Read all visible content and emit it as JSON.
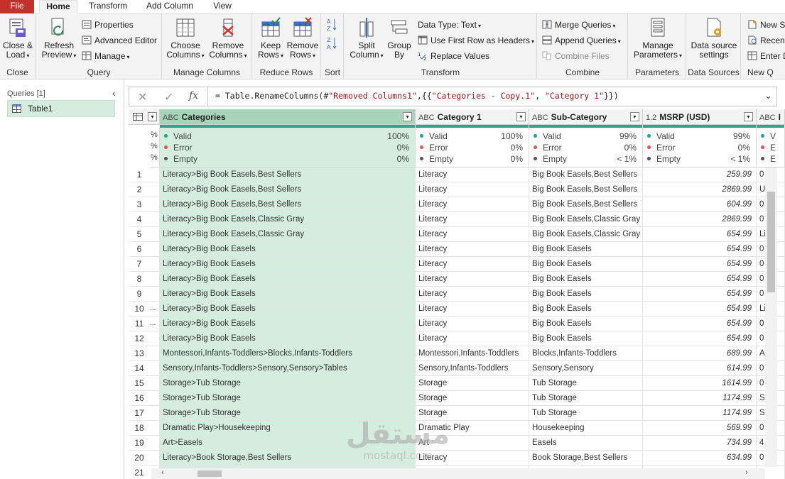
{
  "tabs": {
    "file": "File",
    "home": "Home",
    "transform": "Transform",
    "add_column": "Add Column",
    "view": "View"
  },
  "ribbon": {
    "close": {
      "btn1": "Close &",
      "btn2": "Load",
      "label": "Close"
    },
    "query": {
      "refresh1": "Refresh",
      "refresh2": "Preview",
      "properties": "Properties",
      "advanced": "Advanced Editor",
      "manage": "Manage",
      "label": "Query"
    },
    "manage_columns": {
      "choose1": "Choose",
      "choose2": "Columns",
      "remove1": "Remove",
      "remove2": "Columns",
      "label": "Manage Columns"
    },
    "reduce_rows": {
      "keep1": "Keep",
      "keep2": "Rows",
      "remove1": "Remove",
      "remove2": "Rows",
      "label": "Reduce Rows"
    },
    "sort": {
      "label": "Sort"
    },
    "transform": {
      "split1": "Split",
      "split2": "Column",
      "group1": "Group",
      "group2": "By",
      "datatype": "Data Type: Text",
      "firstrow": "Use First Row as Headers",
      "replace": "Replace Values",
      "label": "Transform"
    },
    "combine": {
      "merge": "Merge Queries",
      "append": "Append Queries",
      "combine_files": "Combine Files",
      "label": "Combine"
    },
    "parameters": {
      "manage1": "Manage",
      "manage2": "Parameters",
      "label": "Parameters"
    },
    "data_sources": {
      "ds1": "Data source",
      "ds2": "settings",
      "label": "Data Sources"
    },
    "new_query": {
      "new_source": "New So",
      "recent": "Recent",
      "enter": "Enter D",
      "label": "New Q"
    }
  },
  "queries_pane": {
    "header": "Queries [1]",
    "items": [
      {
        "label": "Table1"
      }
    ]
  },
  "formula": {
    "prefix": "= Table.RenameColumns(#",
    "s1": "\"Removed Columns1\"",
    "mid": ",{{",
    "s2": "\"Categories - Copy.1\"",
    "comma": ", ",
    "s3": "\"Category 1\"",
    "suffix": "}})"
  },
  "columns": [
    {
      "type": "ABC",
      "name": "Categories",
      "stats": {
        "valid": "100%",
        "error": "0%",
        "empty": "0%"
      }
    },
    {
      "type": "ABC",
      "name": "Category 1",
      "stats": {
        "valid": "100%",
        "error": "0%",
        "empty": "0%"
      }
    },
    {
      "type": "ABC",
      "name": "Sub-Category",
      "stats": {
        "valid": "99%",
        "error": "0%",
        "empty": "< 1%"
      }
    },
    {
      "type": "1.2",
      "name": "MSRP (USD)",
      "stats": {
        "valid": "99%",
        "error": "0%",
        "empty": "< 1%"
      }
    },
    {
      "type": "ABC",
      "name": "I",
      "stats": {
        "valid": "V",
        "error": "E",
        "empty": "E"
      }
    }
  ],
  "stat_labels": {
    "valid": "Valid",
    "error": "Error",
    "empty": "Empty"
  },
  "prev_col_partial": {
    "r1": "%",
    "r2": "%",
    "r3": "%"
  },
  "colors": {
    "valid": "#1aa38d",
    "error": "#e0524f",
    "empty": "#555555",
    "accent": "#28a78b",
    "selected": "#d5eddf"
  },
  "rows": [
    {
      "n": "1",
      "prev": "",
      "c1": "Literacy>Big Book Easels,Best Sellers",
      "c2": "Literacy",
      "c3": "Big Book Easels,Best Sellers",
      "c4": "259.99",
      "c5": "0"
    },
    {
      "n": "2",
      "prev": "",
      "c1": "Literacy>Big Book Easels,Best Sellers",
      "c2": "Literacy",
      "c3": "Big Book Easels,Best Sellers",
      "c4": "2869.99",
      "c5": "U"
    },
    {
      "n": "3",
      "prev": "",
      "c1": "Literacy>Big Book Easels,Best Sellers",
      "c2": "Literacy",
      "c3": "Big Book Easels,Best Sellers",
      "c4": "604.99",
      "c5": "0"
    },
    {
      "n": "4",
      "prev": "",
      "c1": "Literacy>Big Book Easels,Classic Gray",
      "c2": "Literacy",
      "c3": "Big Book Easels,Classic Gray",
      "c4": "2869.99",
      "c5": "0"
    },
    {
      "n": "5",
      "prev": "",
      "c1": "Literacy>Big Book Easels,Classic Gray",
      "c2": "Literacy",
      "c3": "Big Book Easels,Classic Gray",
      "c4": "654.99",
      "c5": "Li"
    },
    {
      "n": "6",
      "prev": "",
      "c1": "Literacy>Big Book Easels",
      "c2": "Literacy",
      "c3": "Big Book Easels",
      "c4": "654.99",
      "c5": "0"
    },
    {
      "n": "7",
      "prev": "",
      "c1": "Literacy>Big Book Easels",
      "c2": "Literacy",
      "c3": "Big Book Easels",
      "c4": "654.99",
      "c5": "0"
    },
    {
      "n": "8",
      "prev": "",
      "c1": "Literacy>Big Book Easels",
      "c2": "Literacy",
      "c3": "Big Book Easels",
      "c4": "654.99",
      "c5": "0"
    },
    {
      "n": "9",
      "prev": "",
      "c1": "Literacy>Big Book Easels",
      "c2": "Literacy",
      "c3": "Big Book Easels",
      "c4": "654.99",
      "c5": "0"
    },
    {
      "n": "10",
      "prev": "...",
      "c1": "Literacy>Big Book Easels",
      "c2": "Literacy",
      "c3": "Big Book Easels",
      "c4": "654.99",
      "c5": "Li"
    },
    {
      "n": "11",
      "prev": "...",
      "c1": "Literacy>Big Book Easels",
      "c2": "Literacy",
      "c3": "Big Book Easels",
      "c4": "654.99",
      "c5": "0"
    },
    {
      "n": "12",
      "prev": "",
      "c1": "Literacy>Big Book Easels",
      "c2": "Literacy",
      "c3": "Big Book Easels",
      "c4": "654.99",
      "c5": "0"
    },
    {
      "n": "13",
      "prev": "",
      "c1": "Montessori,Infants-Toddlers>Blocks,Infants-Toddlers",
      "c2": "Montessori,Infants-Toddlers",
      "c3": "Blocks,Infants-Toddlers",
      "c4": "689.99",
      "c5": "A"
    },
    {
      "n": "14",
      "prev": "",
      "c1": "Sensory,Infants-Toddlers>Sensory,Sensory>Tables",
      "c2": "Sensory,Infants-Toddlers",
      "c3": "Sensory,Sensory",
      "c4": "614.99",
      "c5": "0"
    },
    {
      "n": "15",
      "prev": "",
      "c1": "Storage>Tub Storage",
      "c2": "Storage",
      "c3": "Tub Storage",
      "c4": "1614.99",
      "c5": "0"
    },
    {
      "n": "16",
      "prev": "",
      "c1": "Storage>Tub Storage",
      "c2": "Storage",
      "c3": "Tub Storage",
      "c4": "1174.99",
      "c5": "S"
    },
    {
      "n": "17",
      "prev": "",
      "c1": "Storage>Tub Storage",
      "c2": "Storage",
      "c3": "Tub Storage",
      "c4": "1174.99",
      "c5": "S"
    },
    {
      "n": "18",
      "prev": "",
      "c1": "Dramatic Play>Housekeeping",
      "c2": "Dramatic Play",
      "c3": "Housekeeping",
      "c4": "569.99",
      "c5": "0"
    },
    {
      "n": "19",
      "prev": "",
      "c1": "Art>Easels",
      "c2": "Art",
      "c3": "Easels",
      "c4": "734.99",
      "c5": "4"
    },
    {
      "n": "20",
      "prev": "",
      "c1": "Literacy>Book Storage,Best Sellers",
      "c2": "Literacy",
      "c3": "Book Storage,Best Sellers",
      "c4": "634.99",
      "c5": "0"
    },
    {
      "n": "21",
      "prev": "",
      "c1": "",
      "c2": "",
      "c3": "",
      "c4": "",
      "c5": ""
    }
  ],
  "watermark": {
    "arabic": "مستقل",
    "latin": "mostaql.com"
  }
}
